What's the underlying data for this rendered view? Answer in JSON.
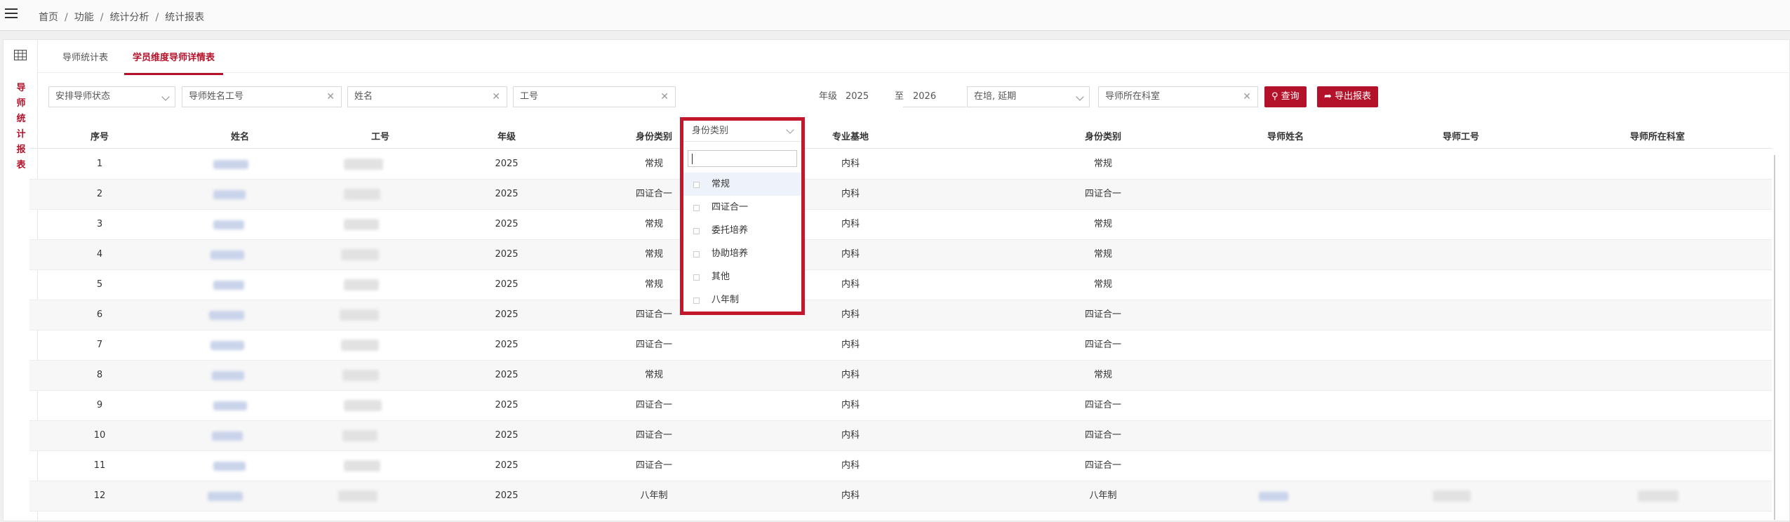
{
  "breadcrumb": [
    "首页",
    "功能",
    "统计分析",
    "统计报表"
  ],
  "sidebar_vertical_label": [
    "导",
    "师",
    "统",
    "计",
    "报",
    "表"
  ],
  "tabs": [
    {
      "label": "导师统计表",
      "active": false
    },
    {
      "label": "学员维度导师详情表",
      "active": true
    }
  ],
  "filters": {
    "arrange_status": "安排导师状态",
    "tutor_name_id_placeholder": "导师姓名工号",
    "name_placeholder": "姓名",
    "id_placeholder": "工号",
    "identity_placeholder": "身份类别",
    "grade_label": "年级",
    "grade_from": "2025",
    "grade_to_label": "至",
    "grade_to": "2026",
    "status_value": "在培, 延期",
    "tutor_dept_placeholder": "导师所在科室",
    "query_button": "查询",
    "export_button": "导出报表"
  },
  "dropdown": {
    "title": "身份类别",
    "options": [
      "常规",
      "四证合一",
      "委托培养",
      "协助培养",
      "其他",
      "八年制"
    ],
    "hovered_index": 0
  },
  "table": {
    "headers": [
      "序号",
      "姓名",
      "工号",
      "年级",
      "身份类别",
      "专业基地",
      "身份类别",
      "导师姓名",
      "导师工号",
      "导师所在科室"
    ],
    "rows": [
      {
        "no": "1",
        "grade": "2025",
        "identity": "常规",
        "base": "内科",
        "identity2": "常规",
        "has_tutor": false
      },
      {
        "no": "2",
        "grade": "2025",
        "identity": "四证合一",
        "base": "内科",
        "identity2": "四证合一",
        "has_tutor": false
      },
      {
        "no": "3",
        "grade": "2025",
        "identity": "常规",
        "base": "内科",
        "identity2": "常规",
        "has_tutor": false
      },
      {
        "no": "4",
        "grade": "2025",
        "identity": "常规",
        "base": "内科",
        "identity2": "常规",
        "has_tutor": false
      },
      {
        "no": "5",
        "grade": "2025",
        "identity": "常规",
        "base": "内科",
        "identity2": "常规",
        "has_tutor": false
      },
      {
        "no": "6",
        "grade": "2025",
        "identity": "四证合一",
        "base": "内科",
        "identity2": "四证合一",
        "has_tutor": false
      },
      {
        "no": "7",
        "grade": "2025",
        "identity": "四证合一",
        "base": "内科",
        "identity2": "四证合一",
        "has_tutor": false
      },
      {
        "no": "8",
        "grade": "2025",
        "identity": "常规",
        "base": "内科",
        "identity2": "常规",
        "has_tutor": false
      },
      {
        "no": "9",
        "grade": "2025",
        "identity": "四证合一",
        "base": "内科",
        "identity2": "四证合一",
        "has_tutor": false
      },
      {
        "no": "10",
        "grade": "2025",
        "identity": "四证合一",
        "base": "内科",
        "identity2": "四证合一",
        "has_tutor": false
      },
      {
        "no": "11",
        "grade": "2025",
        "identity": "四证合一",
        "base": "内科",
        "identity2": "四证合一",
        "has_tutor": false
      },
      {
        "no": "12",
        "grade": "2025",
        "identity": "八年制",
        "base": "内科",
        "identity2": "八年制",
        "has_tutor": true
      }
    ]
  },
  "colors": {
    "accent": "#b3122a",
    "highlight_border": "#c2182b"
  }
}
